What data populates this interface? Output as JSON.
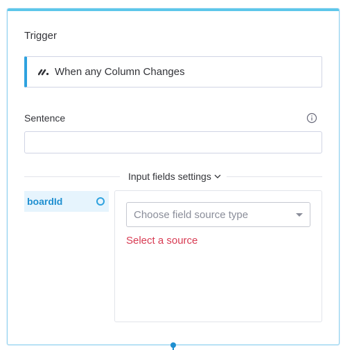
{
  "trigger": {
    "title": "Trigger",
    "selected": "When any Column Changes",
    "icon": "monday-logo-icon"
  },
  "sentence": {
    "label": "Sentence",
    "value": "",
    "info_icon": "info-icon"
  },
  "input_fields": {
    "toggle_label": "Input fields settings",
    "items": [
      {
        "label": "boardId",
        "status_icon": "status-ring-icon"
      }
    ],
    "source_select": {
      "placeholder": "Choose field source type"
    },
    "error": "Select a source"
  },
  "colors": {
    "accent": "#2ea2df",
    "error": "#d83a52",
    "selected_bg": "#e6f4fd"
  }
}
